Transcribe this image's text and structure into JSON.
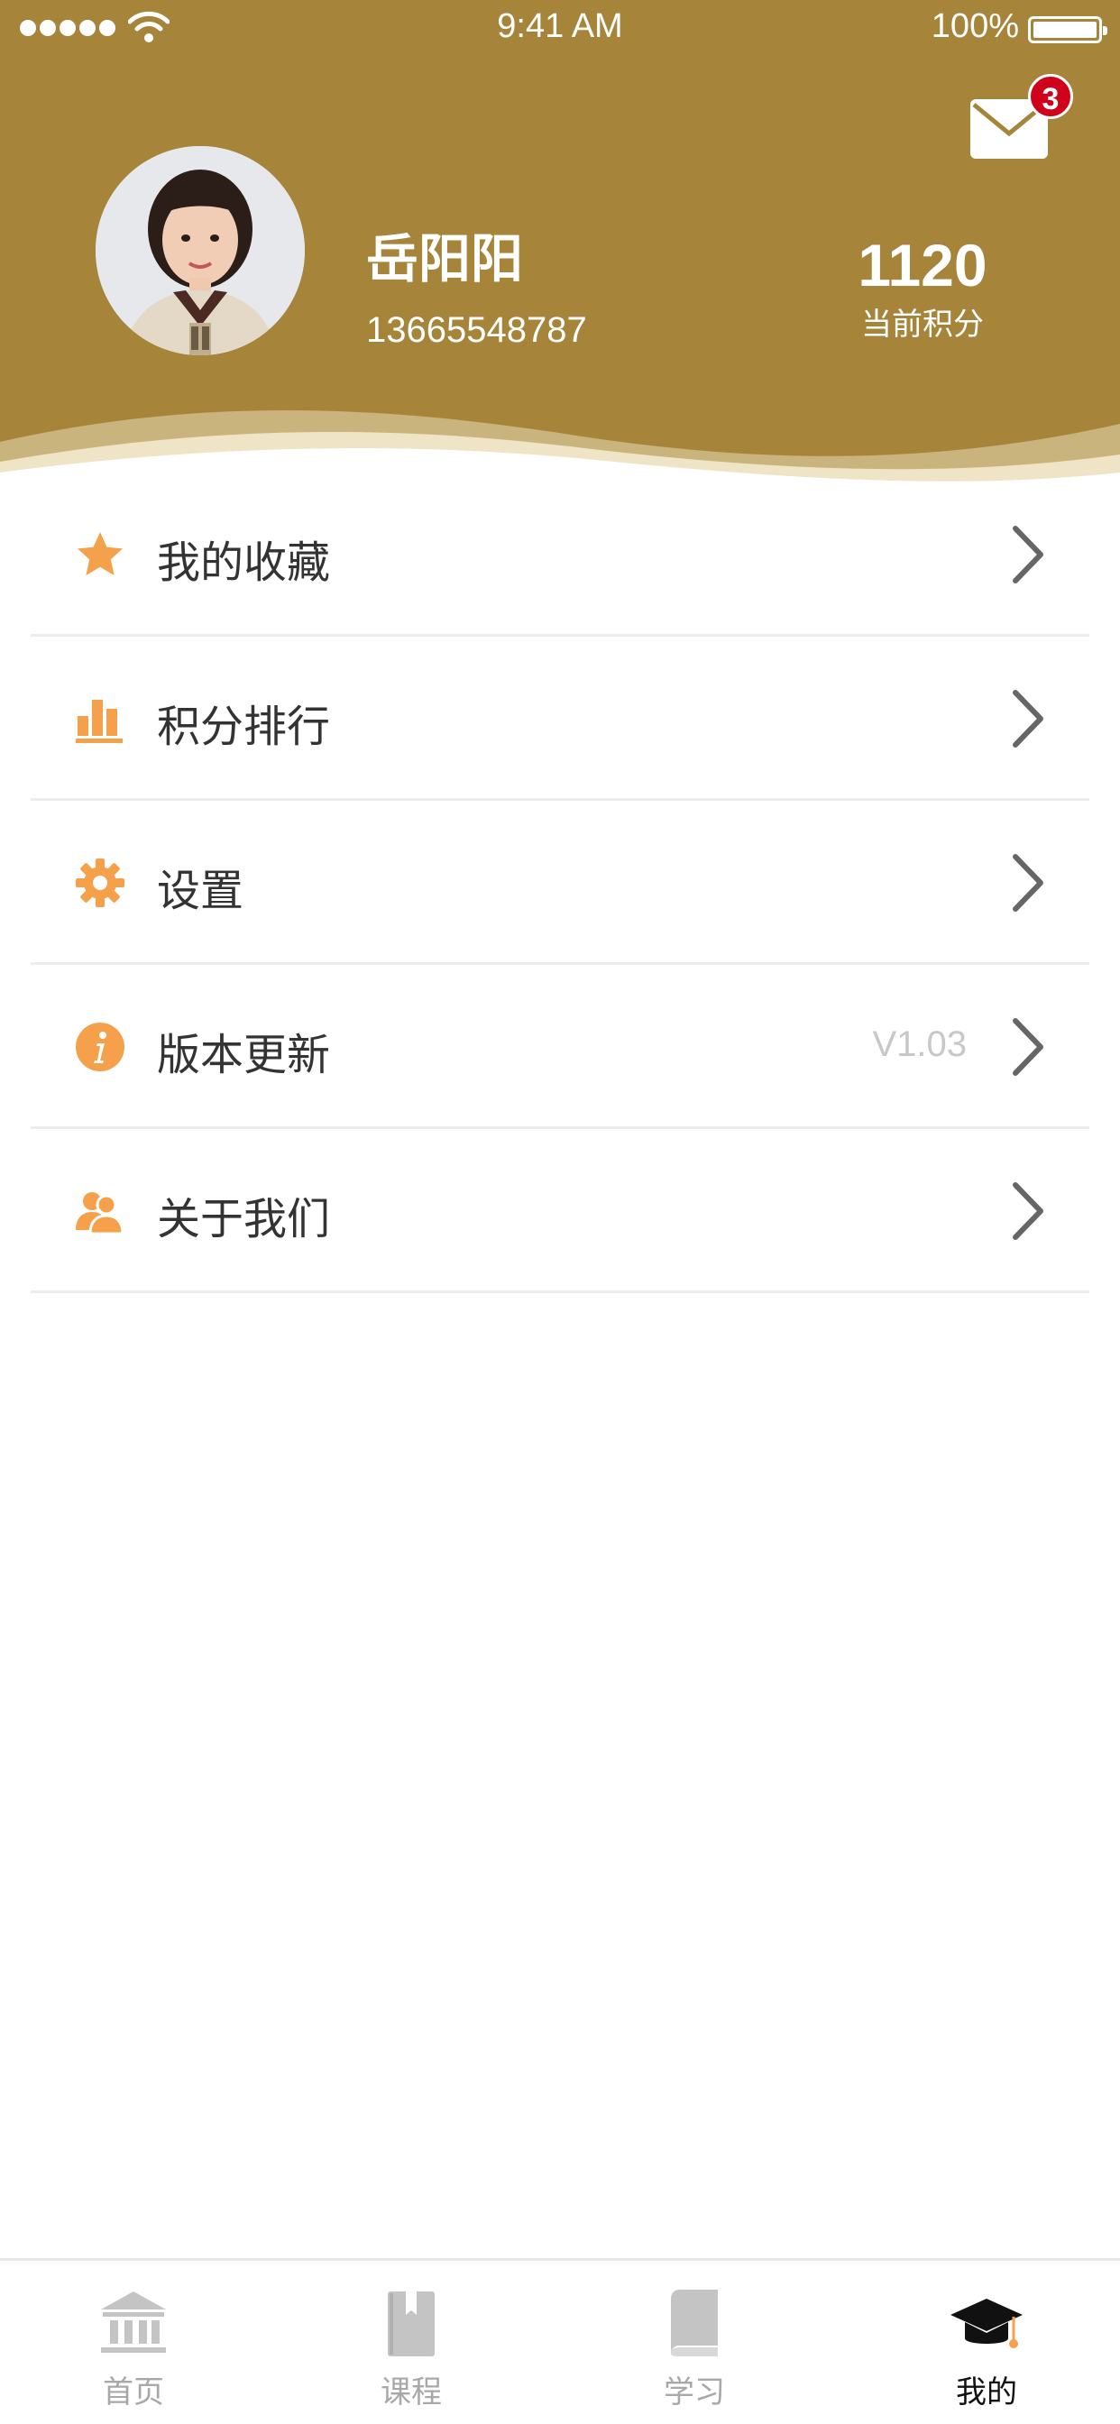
{
  "status_bar": {
    "time": "9:41 AM",
    "battery": "100%"
  },
  "header": {
    "mail_badge": "3",
    "user_name": "岳阳阳",
    "user_phone": "13665548787",
    "points_value": "1120",
    "points_label": "当前积分"
  },
  "menu": {
    "items": [
      {
        "label": "我的收藏",
        "icon": "star-icon"
      },
      {
        "label": "积分排行",
        "icon": "bar-chart-icon"
      },
      {
        "label": "设置",
        "icon": "gear-icon"
      },
      {
        "label": "版本更新",
        "icon": "info-icon",
        "value": "V1.03"
      },
      {
        "label": "关于我们",
        "icon": "users-icon"
      }
    ]
  },
  "tabbar": {
    "tabs": [
      {
        "label": "首页",
        "icon": "bank-icon",
        "active": false
      },
      {
        "label": "课程",
        "icon": "bookmark-book-icon",
        "active": false
      },
      {
        "label": "学习",
        "icon": "book-icon",
        "active": false
      },
      {
        "label": "我的",
        "icon": "graduation-cap-icon",
        "active": true
      }
    ]
  },
  "colors": {
    "header_bg": "#a6853a",
    "accent_icon": "#f5a04a",
    "badge": "#d0021b",
    "tab_inactive": "#a8a8a8",
    "tab_active": "#111111"
  }
}
